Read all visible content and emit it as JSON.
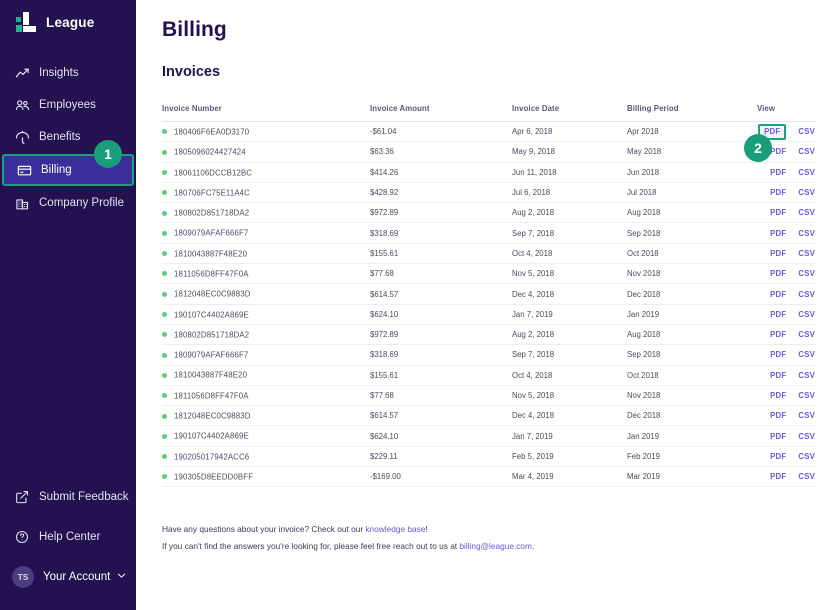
{
  "brand": {
    "name": "League",
    "colors": {
      "sidebar_bg": "#231150",
      "accent_teal": "#17a47c",
      "active_nav_bg": "#3a2d9c",
      "link_purple": "#6a5bd6",
      "status_green": "#5ecc7b",
      "title_purple": "#231150"
    }
  },
  "sidebar": {
    "items": [
      {
        "label": "Insights",
        "icon": "trend-up-icon",
        "active": false
      },
      {
        "label": "Employees",
        "icon": "people-icon",
        "active": false
      },
      {
        "label": "Benefits",
        "icon": "umbrella-icon",
        "active": false
      },
      {
        "label": "Billing",
        "icon": "credit-card-icon",
        "active": true
      },
      {
        "label": "Company Profile",
        "icon": "building-icon",
        "active": false
      }
    ],
    "bottom_items": [
      {
        "label": "Submit Feedback",
        "icon": "external-link-icon"
      },
      {
        "label": "Help Center",
        "icon": "question-circle-icon"
      }
    ],
    "account": {
      "initials": "TS",
      "label": "Your Account",
      "chevron": "chevron-down-icon"
    }
  },
  "annotations": [
    {
      "number": "1",
      "target": "sidebar-item-billing"
    },
    {
      "number": "2",
      "target": "invoice-row-1-pdf-link"
    }
  ],
  "main": {
    "page_title": "Billing",
    "section_title": "Invoices",
    "table": {
      "columns": [
        "Invoice Number",
        "Invoice Amount",
        "Invoice Date",
        "Billing Period",
        "View"
      ],
      "view_links": {
        "pdf": "PDF",
        "csv": "CSV"
      },
      "rows": [
        {
          "status": "active",
          "number": "180406F6EA0D3170",
          "amount": "-$61.04",
          "date": "Apr 6, 2018",
          "period": "Apr 2018"
        },
        {
          "status": "active",
          "number": "1805096024427424",
          "amount": "$63.36",
          "date": "May 9, 2018",
          "period": "May 2018"
        },
        {
          "status": "active",
          "number": "18061106DCCB12BC",
          "amount": "$414.26",
          "date": "Jun 11, 2018",
          "period": "Jun 2018"
        },
        {
          "status": "active",
          "number": "180706FC75E11A4C",
          "amount": "$428.92",
          "date": "Jul 6, 2018",
          "period": "Jul 2018"
        },
        {
          "status": "active",
          "number": "180802D851718DA2",
          "amount": "$972.89",
          "date": "Aug 2, 2018",
          "period": "Aug 2018"
        },
        {
          "status": "active",
          "number": "1809079AFAF666F7",
          "amount": "$318.69",
          "date": "Sep 7, 2018",
          "period": "Sep 2018"
        },
        {
          "status": "active",
          "number": "1810043887F48E20",
          "amount": "$155.61",
          "date": "Oct 4, 2018",
          "period": "Oct 2018"
        },
        {
          "status": "active",
          "number": "1811056D8FF47F0A",
          "amount": "$77.68",
          "date": "Nov 5, 2018",
          "period": "Nov 2018"
        },
        {
          "status": "active",
          "number": "1812048EC0C9883D",
          "amount": "$614.57",
          "date": "Dec 4, 2018",
          "period": "Dec 2018"
        },
        {
          "status": "active",
          "number": "190107C4402A869E",
          "amount": "$624.10",
          "date": "Jan 7, 2019",
          "period": "Jan 2019"
        },
        {
          "status": "active",
          "number": "180802D851718DA2",
          "amount": "$972.89",
          "date": "Aug 2, 2018",
          "period": "Aug 2018"
        },
        {
          "status": "active",
          "number": "1809079AFAF666F7",
          "amount": "$318.69",
          "date": "Sep 7, 2018",
          "period": "Sep 2018"
        },
        {
          "status": "active",
          "number": "1810043887F48E20",
          "amount": "$155.61",
          "date": "Oct 4, 2018",
          "period": "Oct 2018"
        },
        {
          "status": "active",
          "number": "1811056D8FF47F0A",
          "amount": "$77.68",
          "date": "Nov 5, 2018",
          "period": "Nov 2018"
        },
        {
          "status": "active",
          "number": "1812048EC0C9883D",
          "amount": "$614.57",
          "date": "Dec 4, 2018",
          "period": "Dec 2018"
        },
        {
          "status": "active",
          "number": "190107C4402A869E",
          "amount": "$624.10",
          "date": "Jan 7, 2019",
          "period": "Jan 2019"
        },
        {
          "status": "active",
          "number": "190205017942ACC6",
          "amount": "$229.11",
          "date": "Feb 5, 2019",
          "period": "Feb 2019"
        },
        {
          "status": "active",
          "number": "190305D8EEDD0BFF",
          "amount": "-$169.00",
          "date": "Mar 4, 2019",
          "period": "Mar 2019"
        }
      ]
    },
    "footnotes": {
      "line1_prefix": "Have any questions about your invoice? Check out our ",
      "line1_link": "knowledge base",
      "line1_suffix": "!",
      "line2_prefix": "If you can't find the answers you're looking for, please feel free reach out to us at ",
      "line2_link": "billing@league.com",
      "line2_suffix": "."
    }
  }
}
